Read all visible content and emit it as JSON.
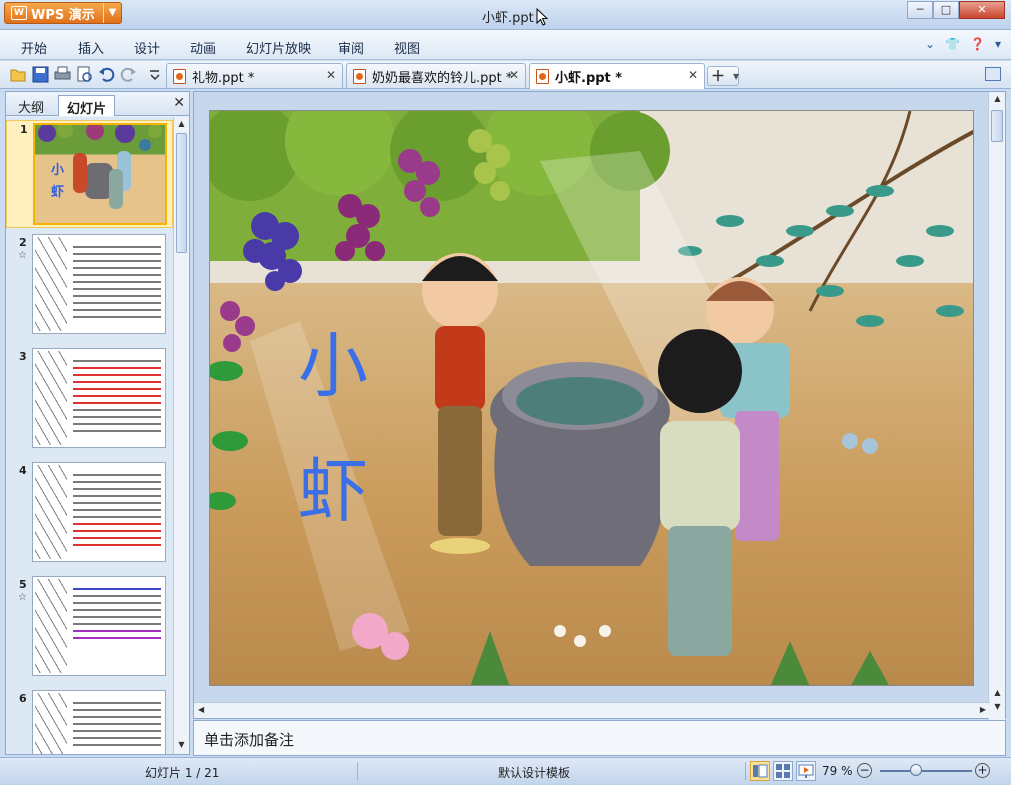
{
  "app": {
    "brand": "WPS 演示",
    "window_title": "小虾.ppt",
    "controls": {
      "minimize": "─",
      "maximize": "□",
      "close": "✕"
    }
  },
  "menu": [
    "开始",
    "插入",
    "设计",
    "动画",
    "幻灯片放映",
    "审阅",
    "视图"
  ],
  "doc_tabs": [
    {
      "label": "礼物.ppt *",
      "active": false
    },
    {
      "label": "奶奶最喜欢的铃儿.ppt *",
      "active": false
    },
    {
      "label": "小虾.ppt *",
      "active": true
    }
  ],
  "panel": {
    "tab_outline": "大纲",
    "tab_slides": "幻灯片",
    "close": "✕",
    "slide_numbers": [
      "1",
      "2",
      "3",
      "4",
      "5",
      "6"
    ],
    "star": "☆"
  },
  "slide": {
    "title_line1": "小",
    "title_line2": "虾",
    "accent": "#3a6fe8"
  },
  "notes": {
    "placeholder": "单击添加备注"
  },
  "status": {
    "slide_counter": "幻灯片 1 / 21",
    "template": "默认设计模板",
    "zoom": "79 %",
    "zoom_level": 0.79
  }
}
